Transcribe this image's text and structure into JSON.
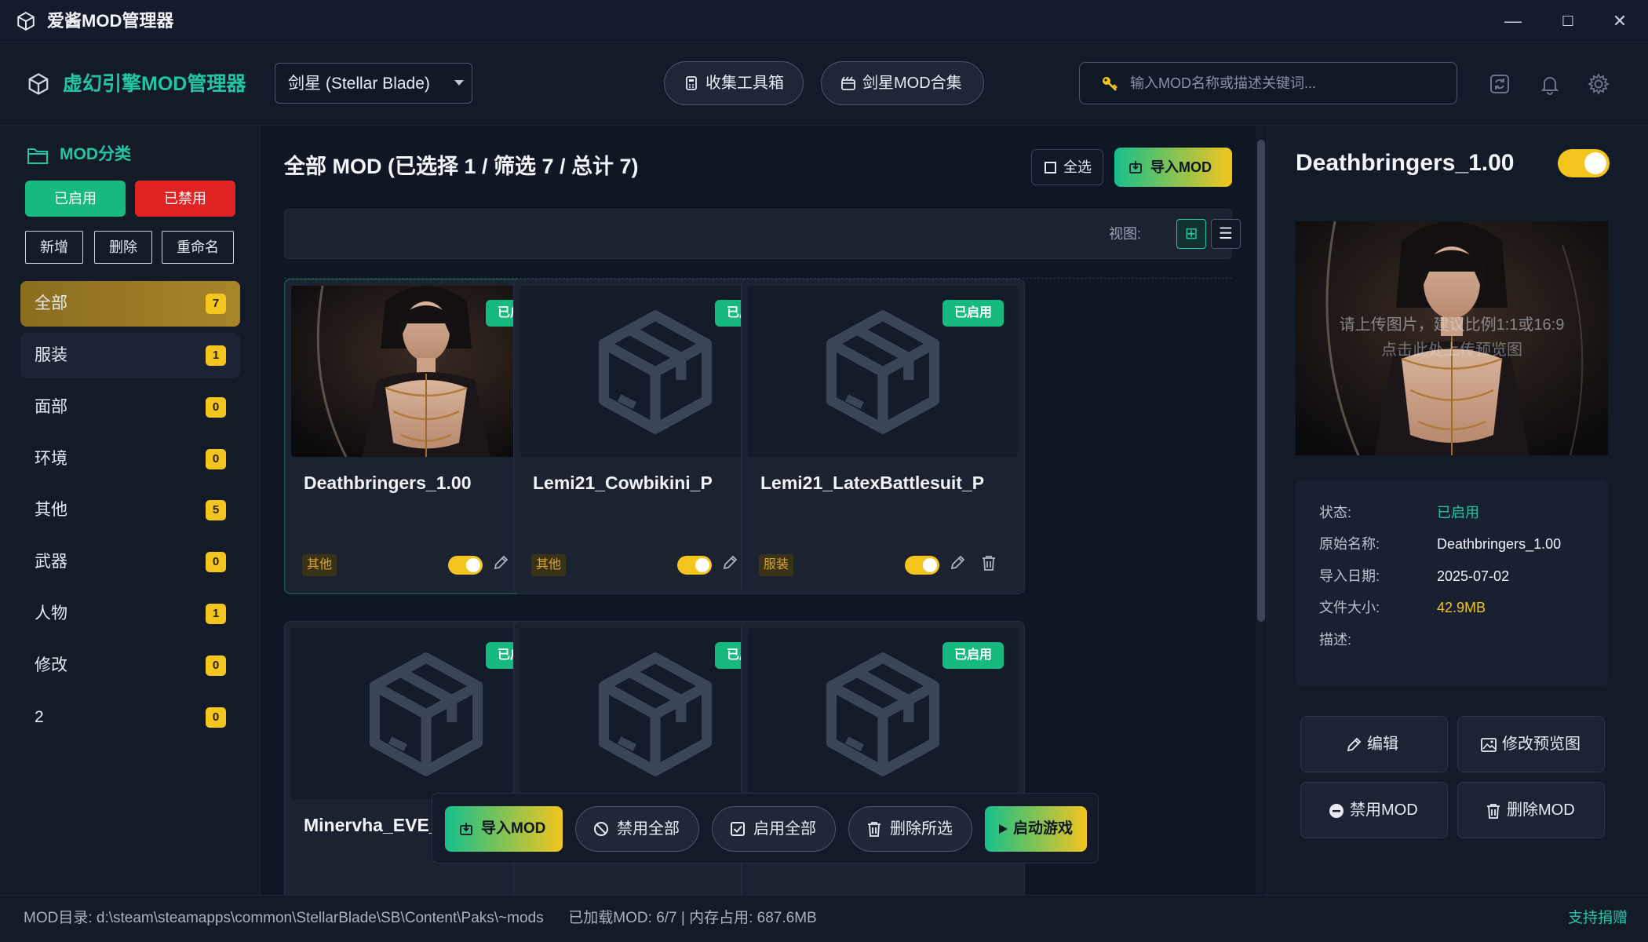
{
  "window": {
    "title": "爱酱MOD管理器",
    "controls": [
      "—",
      "☐",
      "✕"
    ]
  },
  "header": {
    "app_title": "虚幻引擎MOD管理器",
    "game_select": "剑星 (Stellar Blade)",
    "btn_toolbox": "收集工具箱",
    "btn_collection": "剑星MOD合集",
    "search_placeholder": "输入MOD名称或描述关键词..."
  },
  "sidebar": {
    "title": "MOD分类",
    "btn_enabled": "已启用",
    "btn_disabled": "已禁用",
    "btn_add": "新增",
    "btn_delete": "删除",
    "btn_rename": "重命名",
    "categories": [
      {
        "label": "全部",
        "count": "7"
      },
      {
        "label": "服装",
        "count": "1"
      },
      {
        "label": "面部",
        "count": "0"
      },
      {
        "label": "环境",
        "count": "0"
      },
      {
        "label": "其他",
        "count": "5"
      },
      {
        "label": "武器",
        "count": "0"
      },
      {
        "label": "人物",
        "count": "1"
      },
      {
        "label": "修改",
        "count": "0"
      },
      {
        "label": "2",
        "count": "0"
      }
    ]
  },
  "main": {
    "title": "全部 MOD (已选择 1 / 筛选 7 / 总计 7)",
    "btn_select_all": "全选",
    "btn_import": "导入MOD",
    "view_label": "视图:",
    "view_grid_icon": "⊞",
    "view_list_icon": "☰",
    "cards": [
      {
        "name": "Deathbringers_1.00",
        "status": "已启用",
        "tag": "其他",
        "enabled": true
      },
      {
        "name": "Lemi21_Cowbikini_P",
        "status": "已启用",
        "tag": "其他",
        "enabled": true
      },
      {
        "name": "Lemi21_LatexBattlesuit_P",
        "status": "已启用",
        "tag": "服装",
        "enabled": true
      },
      {
        "name": "Minervha_EVE_",
        "status": "已启用",
        "tag": "",
        "enabled": true
      },
      {
        "name": "",
        "status": "已启用",
        "tag": "",
        "enabled": true
      },
      {
        "name": "",
        "status": "已启用",
        "tag": "",
        "enabled": true
      }
    ]
  },
  "floatbar": {
    "import": "导入MOD",
    "disable_all": "禁用全部",
    "enable_all": "启用全部",
    "delete_selected": "删除所选",
    "start_game": "启动游戏"
  },
  "detail": {
    "title": "Deathbringers_1.00",
    "enabled": true,
    "preview_hint_line1": "请上传图片，建议比例1:1或16:9",
    "preview_hint_line2": "点击此处上传预览图",
    "rows": [
      {
        "key": "状态:",
        "value": "已启用"
      },
      {
        "key": "原始名称:",
        "value": "Deathbringers_1.00"
      },
      {
        "key": "导入日期:",
        "value": "2025-07-02"
      },
      {
        "key": "文件大小:",
        "value": "42.9MB"
      },
      {
        "key": "描述:",
        "value": ""
      }
    ],
    "btn_edit": "编辑",
    "btn_change_preview": "修改预览图",
    "btn_disable": "禁用MOD",
    "btn_delete": "删除MOD"
  },
  "footer": {
    "left": "MOD目录: d:\\steam\\steamapps\\common\\StellarBlade\\SB\\Content\\Paks\\~mods      已加载MOD: 6/7 | 内存占用: 687.6MB",
    "right": "支持捐赠"
  },
  "colors": {
    "accent": "#21c6a0",
    "enabled_green": "#16b97e",
    "danger_red": "#e02424",
    "badge_yellow": "#f5c51f",
    "size_yellow": "#f2c51e"
  }
}
